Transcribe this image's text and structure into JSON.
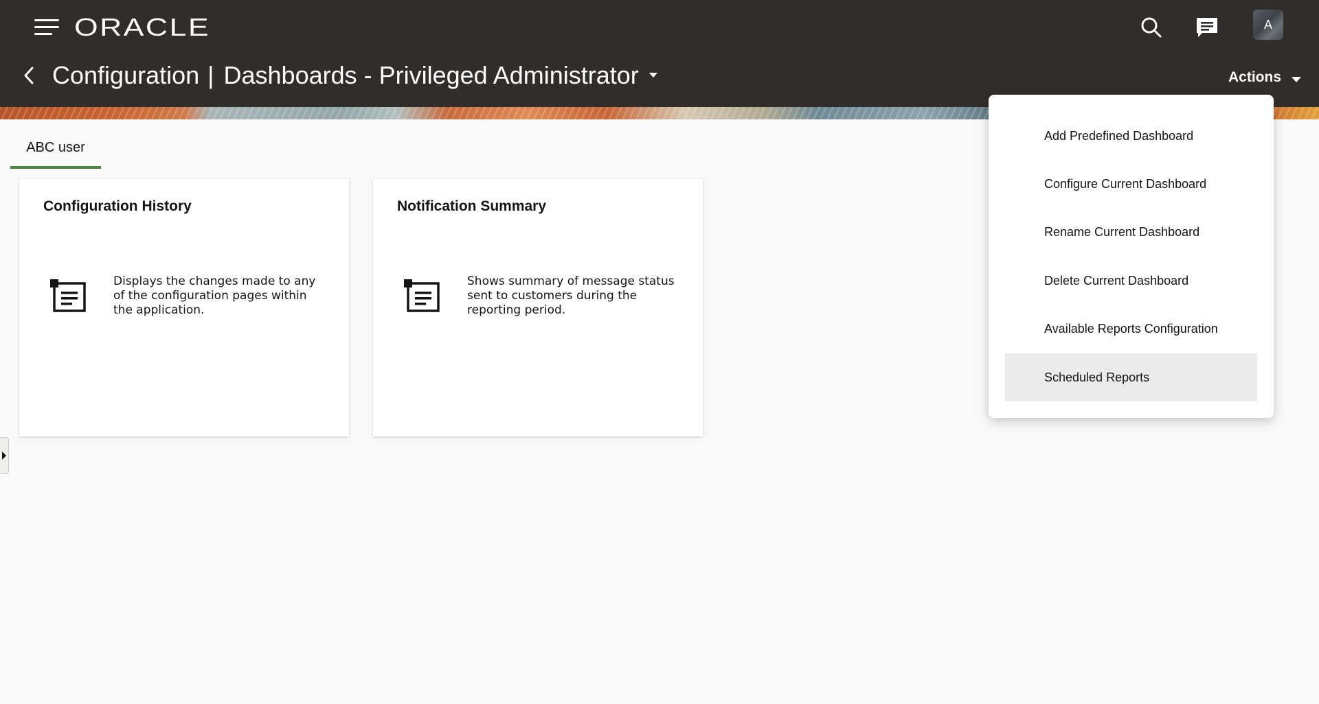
{
  "header": {
    "brand": "ORACLE",
    "icons": {
      "menu": "hamburger-icon",
      "search": "search-icon",
      "messages": "chat-icon"
    },
    "avatar_initial": "A"
  },
  "title_bar": {
    "section": "Configuration",
    "separator": "|",
    "page": "Dashboards - Privileged Administrator",
    "actions_label": "Actions"
  },
  "tabs": [
    {
      "label": "ABC user",
      "selected": true
    }
  ],
  "cards": [
    {
      "title": "Configuration History",
      "icon": "report-icon",
      "description": "Displays the changes made to any of the configuration pages within the application."
    },
    {
      "title": "Notification Summary",
      "icon": "report-icon",
      "description": "Shows summary of message status sent to customers during the reporting period."
    }
  ],
  "actions_menu": {
    "items": [
      {
        "label": "Add Predefined Dashboard"
      },
      {
        "label": "Configure Current Dashboard"
      },
      {
        "label": "Rename Current Dashboard"
      },
      {
        "label": "Delete Current Dashboard"
      },
      {
        "label": "Available Reports Configuration"
      },
      {
        "label": "Scheduled Reports",
        "highlighted": true
      }
    ]
  },
  "colors": {
    "header_bg": "#312d2a",
    "tab_underline": "#508547",
    "page_bg": "#f9f9f9",
    "menu_highlight": "#ebebeb"
  }
}
